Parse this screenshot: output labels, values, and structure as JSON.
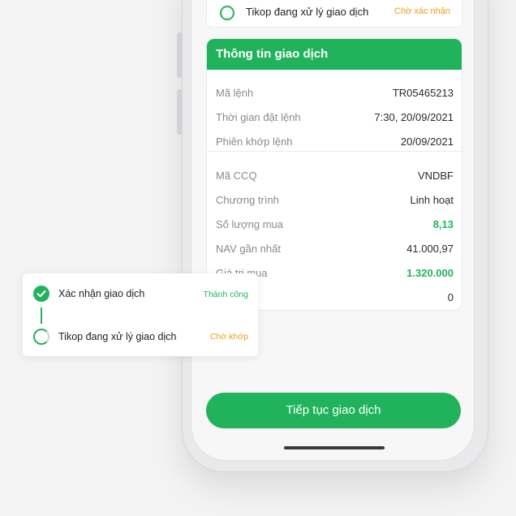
{
  "top_status": {
    "label": "Tikop đang xử lý giao dịch",
    "status": "Chờ xác nhận"
  },
  "transaction_info": {
    "title": "Thông tin giao dịch",
    "rows": [
      {
        "label": "Mã lệnh",
        "value": "TR05465213"
      },
      {
        "label": "Thời gian đặt lệnh",
        "value": "7:30, 20/09/2021"
      },
      {
        "label": "Phiên khớp lệnh",
        "value": "20/09/2021"
      },
      {
        "label": "Mã CCQ",
        "value": "VNDBF"
      },
      {
        "label": "Chương trình",
        "value": "Linh hoạt"
      },
      {
        "label": "Số lượng mua",
        "value": "8,13"
      },
      {
        "label": "NAV gần nhất",
        "value": "41.000,97"
      },
      {
        "label": "Giá trị mua",
        "value": "1.320.000"
      },
      {
        "label": "",
        "value": "0"
      }
    ]
  },
  "cta": {
    "label": "Tiếp tục giao dịch"
  },
  "steps": [
    {
      "label": "Xác nhận giao dịch",
      "status": "Thành công"
    },
    {
      "label": "Tikop đang xử lý giao dịch",
      "status": "Chờ khớp"
    }
  ],
  "colors": {
    "brand_green": "#21b35c",
    "pending_orange": "#f29d12",
    "background": "#f3f3f4"
  }
}
